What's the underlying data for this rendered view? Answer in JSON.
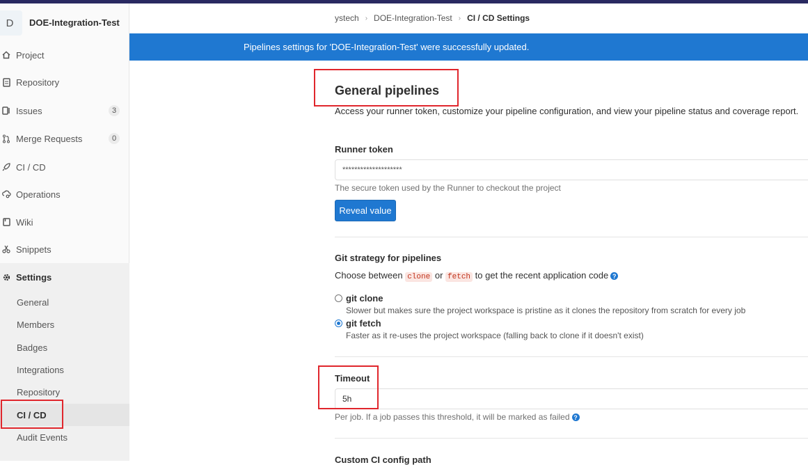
{
  "project": {
    "avatar_letter": "D",
    "name": "DOE-Integration-Test"
  },
  "sidebar": {
    "items": [
      {
        "label": "Project",
        "icon": "home-icon"
      },
      {
        "label": "Repository",
        "icon": "doc-icon"
      },
      {
        "label": "Issues",
        "icon": "issues-icon",
        "count": "3"
      },
      {
        "label": "Merge Requests",
        "icon": "merge-icon",
        "count": "0"
      },
      {
        "label": "CI / CD",
        "icon": "rocket-icon"
      },
      {
        "label": "Operations",
        "icon": "cloud-gear-icon"
      },
      {
        "label": "Wiki",
        "icon": "book-icon"
      },
      {
        "label": "Snippets",
        "icon": "scissors-icon"
      },
      {
        "label": "Settings",
        "icon": "gear-icon"
      }
    ],
    "settings_sub": [
      "General",
      "Members",
      "Badges",
      "Integrations",
      "Repository",
      "CI / CD",
      "Audit Events"
    ]
  },
  "breadcrumb": {
    "group": "ystech",
    "project": "DOE-Integration-Test",
    "current": "CI / CD Settings"
  },
  "flash": "Pipelines settings for 'DOE-Integration-Test' were successfully updated.",
  "general": {
    "title": "General pipelines",
    "description": "Access your runner token, customize your pipeline configuration, and view your pipeline status and coverage report."
  },
  "runner_token": {
    "label": "Runner token",
    "value": "********************",
    "help": "The secure token used by the Runner to checkout the project",
    "reveal_label": "Reveal value"
  },
  "git_strategy": {
    "label": "Git strategy for pipelines",
    "intro_pre": "Choose between",
    "clone_code": "clone",
    "or": "or",
    "fetch_code": "fetch",
    "intro_post": "to get the recent application code",
    "options": [
      {
        "label": "git clone",
        "help": "Slower but makes sure the project workspace is pristine as it clones the repository from scratch for every job",
        "checked": false
      },
      {
        "label": "git fetch",
        "help": "Faster as it re-uses the project workspace (falling back to clone if it doesn't exist)",
        "checked": true
      }
    ]
  },
  "timeout": {
    "label": "Timeout",
    "value": "5h",
    "help": "Per job. If a job passes this threshold, it will be marked as failed"
  },
  "custom_ci": {
    "label": "Custom CI config path"
  },
  "colors": {
    "accent": "#1f78d1",
    "highlight_box": "#e0262c",
    "topbar": "#292961"
  }
}
